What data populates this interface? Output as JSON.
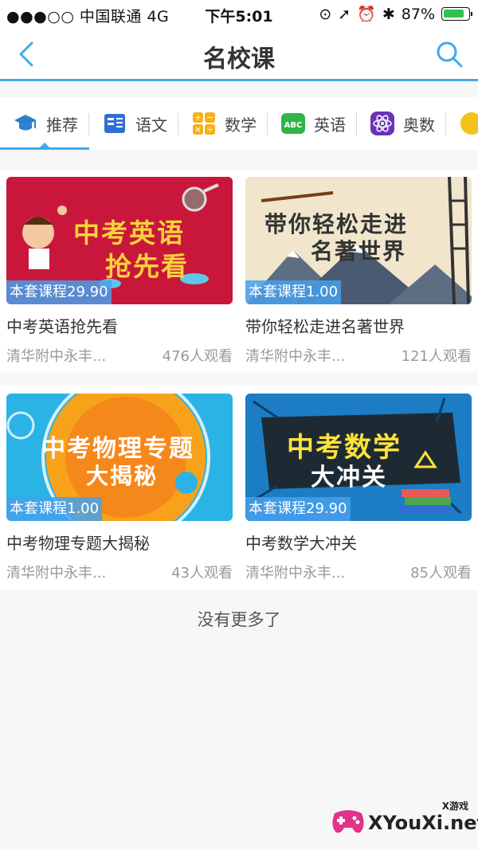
{
  "status_bar": {
    "carrier": "●●●○○ 中国联通  4G",
    "time": "下午5:01",
    "battery": "87%",
    "battery_level": 0.87
  },
  "nav": {
    "title": "名校课",
    "back_icon": "chevron-left-icon",
    "search_icon": "search-icon"
  },
  "tabs": [
    {
      "label": "推荐",
      "icon": "graduation-cap-icon",
      "active": true
    },
    {
      "label": "语文",
      "icon": "book-icon",
      "active": false
    },
    {
      "label": "数学",
      "icon": "calculator-icon",
      "active": false
    },
    {
      "label": "英语",
      "icon": "abc-icon",
      "active": false
    },
    {
      "label": "奥数",
      "icon": "atom-icon",
      "active": false
    }
  ],
  "courses": [
    {
      "thumb_lines": [
        "中考英语",
        "抢先看"
      ],
      "badge": "本套课程29.90",
      "title": "中考英语抢先看",
      "school": "清华附中永丰...",
      "views": "476人观看",
      "colors": {
        "bg": "#c8173a",
        "text": "#f7d23a"
      }
    },
    {
      "thumb_lines": [
        "带你轻松走进",
        "名著世界"
      ],
      "badge": "本套课程1.00",
      "title": "带你轻松走进名著世界",
      "school": "清华附中永丰...",
      "views": "121人观看",
      "colors": {
        "bg": "#f1e6cc",
        "text": "#f3d33a"
      }
    },
    {
      "thumb_lines": [
        "中考物理专题",
        "大揭秘"
      ],
      "badge": "本套课程1.00",
      "title": "中考物理专题大揭秘",
      "school": "清华附中永丰...",
      "views": "43人观看",
      "colors": {
        "bg": "#2bb3e6",
        "text": "#ffe34a"
      }
    },
    {
      "thumb_lines": [
        "中考数学",
        "大冲关"
      ],
      "badge": "本套课程29.90",
      "title": "中考数学大冲关",
      "school": "清华附中永丰...",
      "views": "85人观看",
      "colors": {
        "bg": "#1c7cc4",
        "text": "#ffe23a"
      }
    }
  ],
  "footer": {
    "no_more": "没有更多了"
  },
  "watermark": {
    "text": "XYouXi.net",
    "small": "X游戏"
  },
  "colors": {
    "accent": "#3eaaf0",
    "badge": "#46a0eb"
  }
}
